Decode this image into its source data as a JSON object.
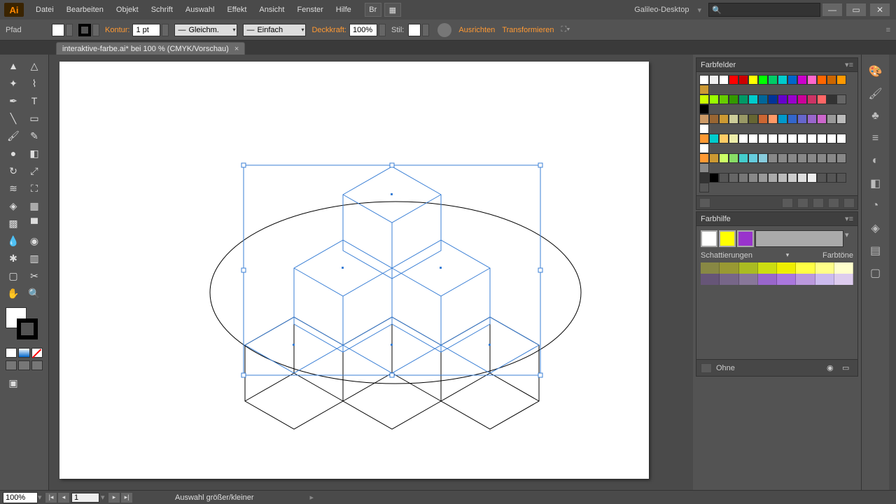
{
  "menubar": {
    "logo": "Ai",
    "items": [
      "Datei",
      "Bearbeiten",
      "Objekt",
      "Schrift",
      "Auswahl",
      "Effekt",
      "Ansicht",
      "Fenster",
      "Hilfe"
    ],
    "app_title": "Galileo-Desktop",
    "search_placeholder": ""
  },
  "controlbar": {
    "selection_label": "Pfad",
    "stroke_label": "Kontur:",
    "stroke_weight": "1 pt",
    "stroke_profile": "Gleichm.",
    "brush_def": "Einfach",
    "opacity_label": "Deckkraft:",
    "opacity_value": "100%",
    "style_label": "Stil:",
    "align_label": "Ausrichten",
    "transform_label": "Transformieren"
  },
  "tabbar": {
    "active_tab": "interaktive-farbe.ai* bei 100 % (CMYK/Vorschau)"
  },
  "panels": {
    "swatches_title": "Farbfelder",
    "colorguide_title": "Farbhilfe",
    "shades_label": "Schattierungen",
    "tints_label": "Farbtöne",
    "none_label": "Ohne",
    "swatch_colors": [
      [
        "#ffffff",
        "#f0f0f0",
        "#ffffff",
        "#ff0000",
        "#cc0000",
        "#ffff00",
        "#00ff00",
        "#00cc66",
        "#00cccc",
        "#0066cc",
        "#cc00cc",
        "#ff66cc",
        "#ff6600",
        "#cc6600",
        "#ff9900",
        "#cc9933"
      ],
      [
        "#ccff00",
        "#99ff00",
        "#66cc00",
        "#339900",
        "#009966",
        "#00cccc",
        "#006699",
        "#003399",
        "#6600cc",
        "#9900cc",
        "#cc0099",
        "#cc3366",
        "#ff6666",
        "#333333",
        "#666666",
        "#000000"
      ],
      [
        "#cc9966",
        "#996633",
        "#cc9933",
        "#cccc99",
        "#999966",
        "#666633",
        "#cc6633",
        "#ff9966",
        "#0099cc",
        "#3366cc",
        "#6666cc",
        "#9966cc",
        "#cc66cc",
        "#999999",
        "#bbbbbb",
        "#ffffff"
      ],
      [
        "#ff9933",
        "#00cccc",
        "#ffcc66",
        "#eeeeaa",
        "#ffffff",
        "#ffffff",
        "#ffffff",
        "#ffffff",
        "#ffffff",
        "#ffffff",
        "#ffffff",
        "#ffffff",
        "#ffffff",
        "#ffffff",
        "#ffffff",
        "#ffffff"
      ],
      [
        "#ff9933",
        "#cc9933",
        "#ccff66",
        "#88dd66",
        "#44cccc",
        "#66ccdd",
        "#88ccdd",
        "#888888",
        "#888888",
        "#888888",
        "#888888",
        "#888888",
        "#888888",
        "#888888",
        "#888888",
        "#888888"
      ],
      [
        "#333333",
        "#000000",
        "#555555",
        "#666666",
        "#777777",
        "#888888",
        "#999999",
        "#aaaaaa",
        "#bbbbbb",
        "#cccccc",
        "#dddddd",
        "#eeeeee",
        "#555555",
        "#555555",
        "#555555",
        "#555555"
      ]
    ],
    "guide_colors": {
      "base1": "#ffff00",
      "base2": "#9933cc",
      "row1": [
        "#888844",
        "#999933",
        "#aabb22",
        "#ccdd11",
        "#eeee00",
        "#ffff44",
        "#ffff88",
        "#ffffcc"
      ],
      "row2": [
        "#665577",
        "#776688",
        "#887799",
        "#9966cc",
        "#aa77dd",
        "#bb99dd",
        "#ccbbee",
        "#ddccee"
      ]
    }
  },
  "statusbar": {
    "zoom": "100%",
    "page": "1",
    "message": "Auswahl größer/kleiner"
  }
}
